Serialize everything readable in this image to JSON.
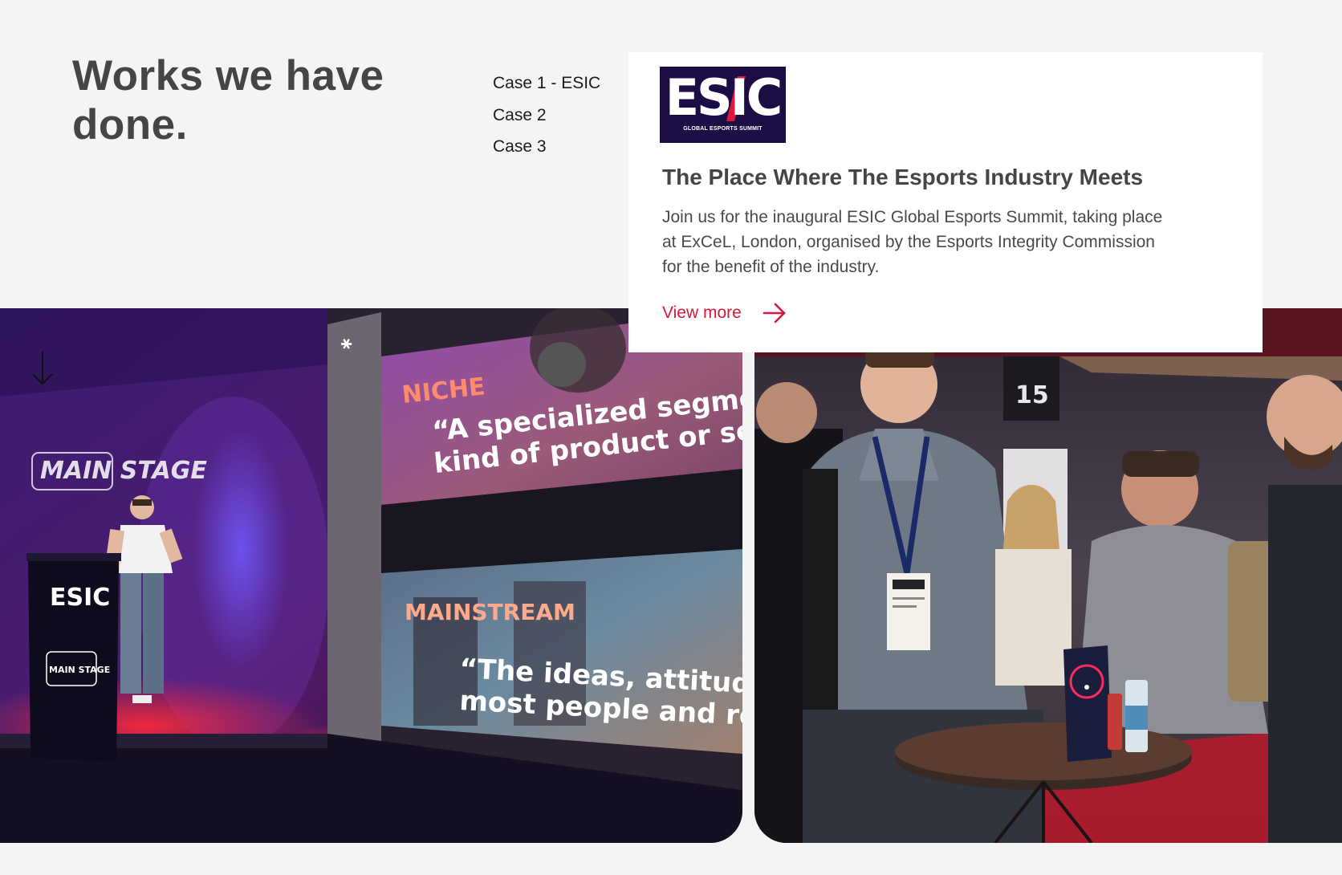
{
  "section": {
    "title": "Works we have done."
  },
  "cases": [
    {
      "label": "Case 1 - ESIC"
    },
    {
      "label": "Case 2"
    },
    {
      "label": "Case 3"
    }
  ],
  "card": {
    "logo": {
      "word": "ESIC",
      "tagline": "GLOBAL ESPORTS SUMMIT"
    },
    "title": "The Place Where The Esports Industry Meets",
    "body": "Join us for the inaugural ESIC Global Esports Summit, taking place at ExCeL, London, organised by the Esports Integrity Commission for the benefit of the industry.",
    "link_label": "View more"
  },
  "photos": {
    "left": {
      "stage_sign": "MAIN STAGE",
      "podium_logo": "ESIC",
      "podium_sign": "MAIN STAGE",
      "slide_top_heading": "NICHE",
      "slide_top_quote_1": "“A specialized segmen",
      "slide_top_quote_2": "kind of product or serv",
      "slide_bottom_heading": "MAINSTREAM",
      "slide_bottom_quote_1": "“The ideas, attitudes",
      "slide_bottom_quote_2": "most people and reg"
    },
    "right": {
      "room_number": "15"
    }
  },
  "colors": {
    "background": "#f4f4f4",
    "heading": "#454545",
    "accent": "#d4173a",
    "logo_bg": "#1c0d45"
  }
}
